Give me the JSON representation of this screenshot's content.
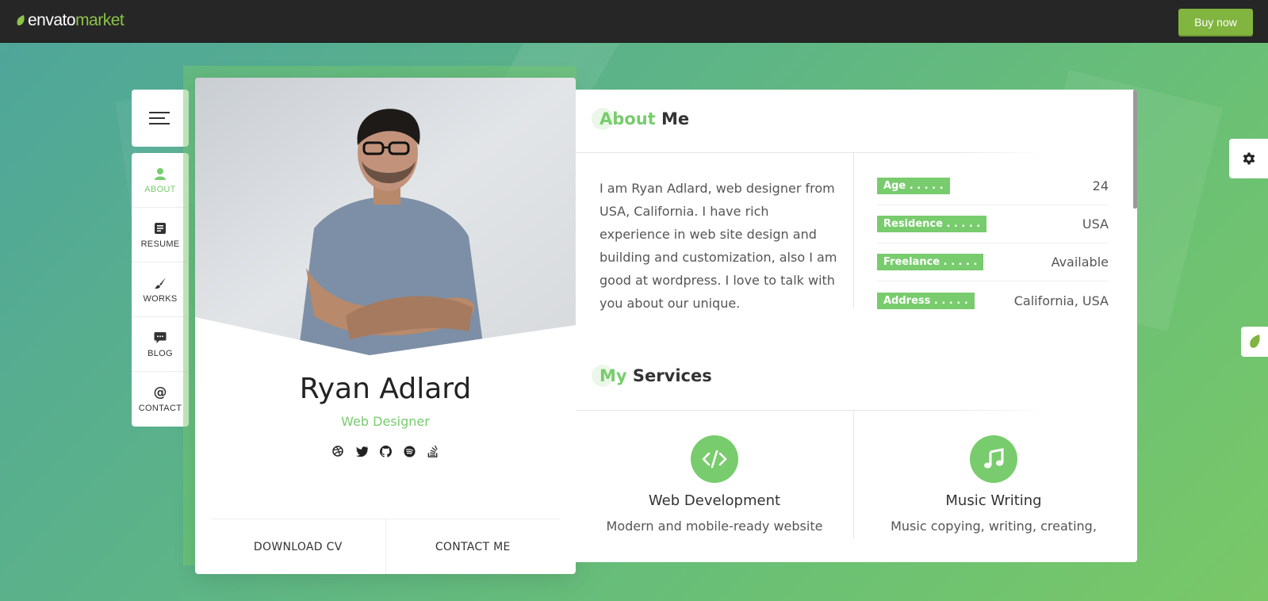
{
  "topbar": {
    "brand_primary": "envato",
    "brand_secondary": "market",
    "buy_label": "Buy now",
    "accent": "#82b440"
  },
  "nav": {
    "items": [
      {
        "label": "ABOUT",
        "icon": "user-icon",
        "active": true
      },
      {
        "label": "RESUME",
        "icon": "resume-icon",
        "active": false
      },
      {
        "label": "WORKS",
        "icon": "brush-icon",
        "active": false
      },
      {
        "label": "BLOG",
        "icon": "chat-icon",
        "active": false
      },
      {
        "label": "CONTACT",
        "icon": "at-icon",
        "active": false
      }
    ]
  },
  "profile": {
    "name": "Ryan Adlard",
    "role": "Web Designer",
    "socials": [
      "dribbble-icon",
      "twitter-icon",
      "github-icon",
      "spotify-icon",
      "stackoverflow-icon"
    ],
    "download_label": "DOWNLOAD CV",
    "contact_label": "CONTACT ME"
  },
  "about": {
    "title_highlight": "About",
    "title_rest": " Me",
    "text": "I am Ryan Adlard, web designer from USA, California. I have rich experience in web site design and building and customization, also I am good at wordpress. I love to talk with you about our unique.",
    "info": [
      {
        "key": "Age . . . . .",
        "value": "24"
      },
      {
        "key": "Residence . . . . .",
        "value": "USA"
      },
      {
        "key": "Freelance . . . . .",
        "value": "Available"
      },
      {
        "key": "Address . . . . .",
        "value": "California, USA"
      }
    ]
  },
  "services": {
    "title_highlight": "My",
    "title_rest": " Services",
    "items": [
      {
        "title": "Web Development",
        "desc": "Modern and mobile-ready website",
        "icon": "code-icon"
      },
      {
        "title": "Music Writing",
        "desc": "Music copying, writing, creating,",
        "icon": "music-icon"
      }
    ]
  },
  "colors": {
    "accent_green": "#78cc6d",
    "topbar_bg": "#262626"
  }
}
